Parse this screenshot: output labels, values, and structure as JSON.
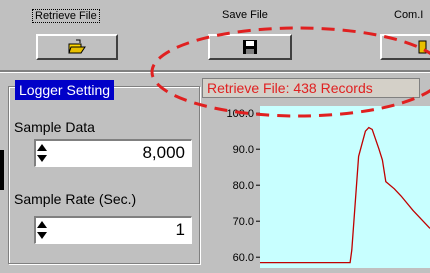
{
  "toolbar": {
    "retrieve_label": "Retrieve File",
    "save_label": "Save File",
    "com_label": "Com.I"
  },
  "logger": {
    "title": "Logger Setting",
    "sample_data_label": "Sample Data",
    "sample_data_value": "8,000",
    "sample_rate_label": "Sample Rate (Sec.)",
    "sample_rate_value": "1"
  },
  "status": {
    "text": "Retrieve File: 438 Records"
  },
  "chart_data": {
    "type": "line",
    "ytick_labels": [
      "100.0",
      "90.0",
      "80.0",
      "70.0",
      "60.0"
    ],
    "yticks": [
      100,
      90,
      80,
      70,
      60
    ],
    "ylim": [
      57,
      102
    ],
    "xlim": [
      0,
      100
    ],
    "series": [
      {
        "color": "#c00000",
        "x": [
          0,
          53,
          54,
          58,
          62,
          64,
          66,
          70,
          72,
          74,
          79,
          83,
          90,
          100
        ],
        "y": [
          58.5,
          58.5,
          62,
          88,
          95,
          96,
          95.5,
          90,
          87,
          81,
          79,
          77,
          73,
          68
        ]
      }
    ],
    "plot_bg": "#c8ffff",
    "grid": true
  },
  "colors": {
    "title_bg": "#0000c8",
    "status_red": "#e02020",
    "annotation_red": "#e02020"
  },
  "icons": {
    "retrieve": "open-folder-icon",
    "save": "floppy-disk-icon"
  }
}
